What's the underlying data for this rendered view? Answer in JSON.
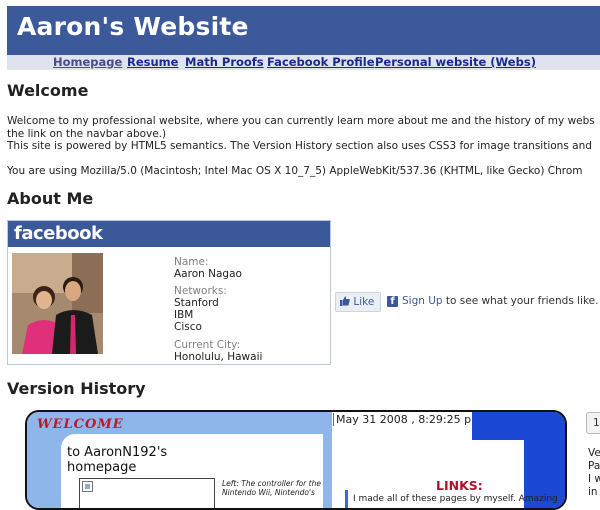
{
  "header": {
    "title": "Aaron's Website"
  },
  "nav": [
    {
      "label": "Homepage"
    },
    {
      "label": "Resume"
    },
    {
      "label": "Math Proofs"
    },
    {
      "label": "Facebook Profile"
    },
    {
      "label": "Personal website (Webs)"
    }
  ],
  "welcome": {
    "heading": "Welcome",
    "line1": "Welcome to my professional website, where you can currently learn more about me and the history of my webs",
    "line2": "the link on the navbar above.)",
    "line3": "This site is powered by HTML5 semantics. The Version History section also uses CSS3 for image transitions and",
    "ua": "You are using Mozilla/5.0 (Macintosh; Intel Mac OS X 10_7_5) AppleWebKit/537.36 (KHTML, like Gecko) Chrom"
  },
  "about": {
    "heading": "About Me",
    "badge": {
      "logo": "facebook",
      "name_label": "Name:",
      "name": "Aaron Nagao",
      "networks_label": "Networks:",
      "networks": [
        "Stanford",
        "IBM",
        "Cisco"
      ],
      "city_label": "Current City:",
      "city": "Honolulu, Hawaii"
    },
    "like_label": "Like",
    "signup_link": "Sign Up",
    "signup_rest": " to see what your friends like."
  },
  "version_history": {
    "heading": "Version History",
    "snapshot": {
      "welcome": "WELCOME",
      "title_line1": "to AaronN192's",
      "title_line2": "homepage",
      "date": "May 31 2008 , 8:29:25 pm",
      "caption": "Left: The controller for the Nintendo Wii, Nintendo's",
      "links": "LINKS:",
      "made": "I made all of these pages by myself.  Amazing"
    },
    "side_button": "1",
    "side_lines": [
      "Ve",
      "Pa",
      "I w",
      "in"
    ]
  },
  "colors": {
    "header_bg": "#3c5a9a",
    "nav_bg": "#dfe3ee",
    "facebook_blue": "#3b5998"
  }
}
